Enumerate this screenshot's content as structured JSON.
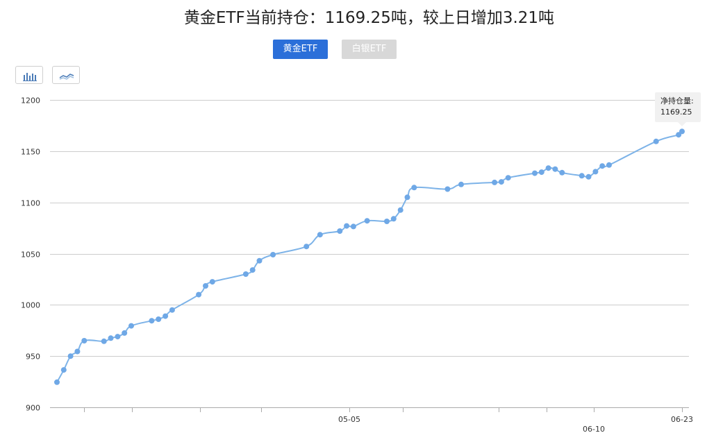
{
  "header": {
    "title": "黄金ETF当前持仓：1169.25吨，较上日增加3.21吨"
  },
  "tabs": [
    {
      "label": "黄金ETF",
      "active": true
    },
    {
      "label": "白银ETF",
      "active": false
    }
  ],
  "toolbar": {
    "bar_icon": "bar-chart-icon",
    "line_icon": "line-chart-icon"
  },
  "tooltip": {
    "label": "净持仓量:",
    "value": "1169.25"
  },
  "colors": {
    "accent": "#2b6fd9",
    "line": "#7db3e8",
    "point": "#6fa8e6",
    "grid": "#cccccc"
  },
  "chart_data": {
    "type": "line",
    "title": "",
    "xlabel": "",
    "ylabel": "",
    "ylim": [
      900,
      1200
    ],
    "yticks": [
      900,
      950,
      1000,
      1050,
      1100,
      1150,
      1200
    ],
    "xtick_labels": [
      "05-05",
      "06-10",
      "06-23"
    ],
    "grid": true,
    "series": [
      {
        "values": [
          924.5,
          936.5,
          950.0,
          954.5,
          965.0,
          964.5,
          967.5,
          969.0,
          972.5,
          979.5,
          984.5,
          986.0,
          989.0,
          995.0,
          1010.0,
          1018.5,
          1022.5,
          1030.0,
          1034.0,
          1043.0,
          1049.0,
          1057.0,
          1068.5,
          1072.0,
          1077.0,
          1076.5,
          1082.0,
          1081.5,
          1084.0,
          1092.5,
          1105.0,
          1114.5,
          1113.0,
          1117.5,
          1119.5,
          1120.0,
          1124.0,
          1128.5,
          1129.5,
          1133.5,
          1132.5,
          1129.0,
          1126.0,
          1125.0,
          1130.0,
          1135.5,
          1136.5,
          1159.5,
          1166.0,
          1169.25
        ]
      }
    ]
  }
}
